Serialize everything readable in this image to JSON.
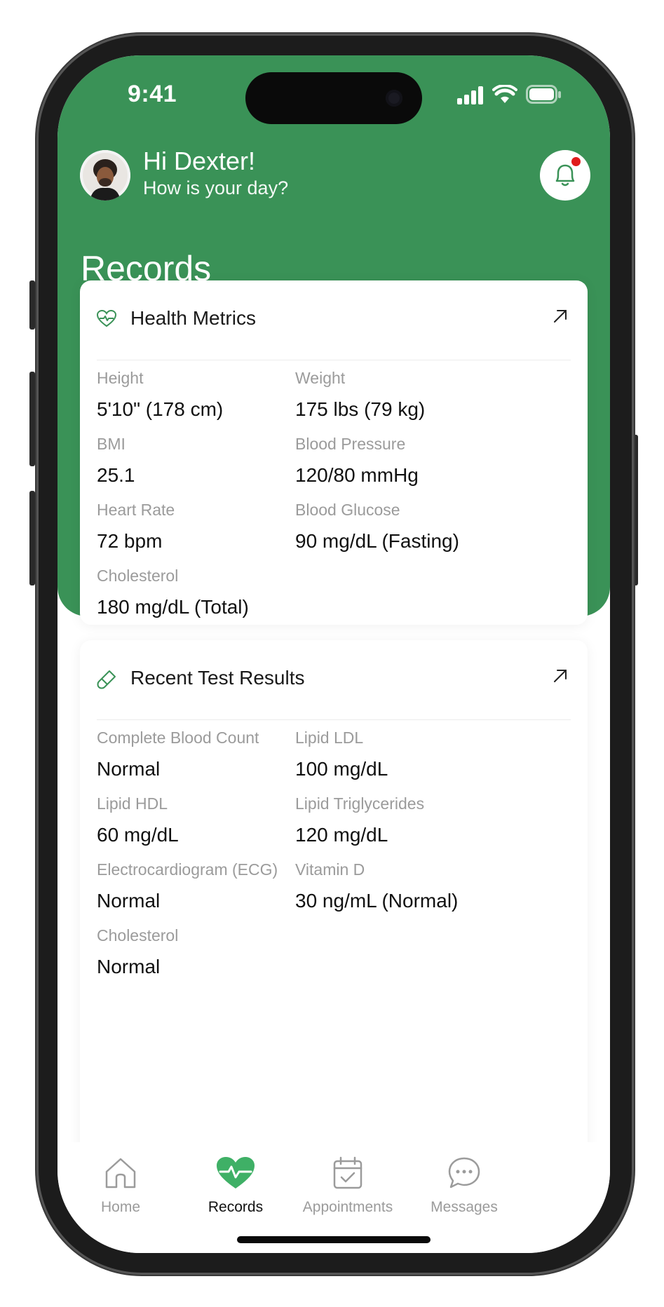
{
  "status_bar": {
    "time": "9:41"
  },
  "header": {
    "greeting": "Hi Dexter!",
    "subtitle": "How is your day?",
    "page_title": "Records"
  },
  "colors": {
    "brand": "#3a9257",
    "notification_dot": "#e01b1b"
  },
  "health_metrics": {
    "title": "Health Metrics",
    "icon": "heart-pulse-icon",
    "items": [
      {
        "label": "Height",
        "value": "5'10\" (178 cm)"
      },
      {
        "label": "Weight",
        "value": "175 lbs (79 kg)"
      },
      {
        "label": "BMI",
        "value": "25.1"
      },
      {
        "label": "Blood Pressure",
        "value": "120/80 mmHg"
      },
      {
        "label": "Heart Rate",
        "value": "72 bpm"
      },
      {
        "label": "Blood Glucose",
        "value": "90 mg/dL (Fasting)"
      },
      {
        "label": "Cholesterol",
        "value": "180 mg/dL (Total)"
      }
    ]
  },
  "test_results": {
    "title": "Recent Test Results",
    "icon": "test-tube-icon",
    "items": [
      {
        "label": "Complete Blood Count",
        "value": "Normal"
      },
      {
        "label": "Lipid LDL",
        "value": "100 mg/dL"
      },
      {
        "label": "Lipid HDL",
        "value": "60 mg/dL"
      },
      {
        "label": "Lipid Triglycerides",
        "value": "120 mg/dL"
      },
      {
        "label": "Electrocardiogram (ECG)",
        "value": "Normal"
      },
      {
        "label": "Vitamin D",
        "value": "30 ng/mL (Normal)"
      },
      {
        "label": "Cholesterol",
        "value": "Normal"
      }
    ]
  },
  "tabs": [
    {
      "label": "Home",
      "icon": "home-icon",
      "active": false
    },
    {
      "label": "Records",
      "icon": "heart-pulse-icon",
      "active": true
    },
    {
      "label": "Appointments",
      "icon": "calendar-check-icon",
      "active": false
    },
    {
      "label": "Messages",
      "icon": "chat-bubble-icon",
      "active": false
    }
  ]
}
